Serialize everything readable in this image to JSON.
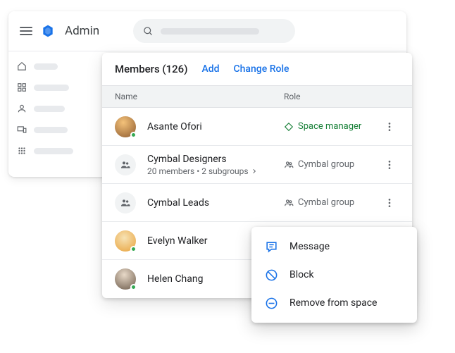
{
  "header": {
    "title": "Admin"
  },
  "members": {
    "title": "Members (126)",
    "add_label": "Add",
    "change_role_label": "Change Role",
    "col_name": "Name",
    "col_role": "Role",
    "rows": [
      {
        "name": "Asante Ofori",
        "role": "Space manager"
      },
      {
        "name": "Cymbal Designers",
        "sub": "20 members  •  2 subgroups",
        "role": "Cymbal group"
      },
      {
        "name": "Cymbal Leads",
        "role": "Cymbal group"
      },
      {
        "name": "Evelyn Walker"
      },
      {
        "name": "Helen Chang"
      }
    ]
  },
  "menu": {
    "message": "Message",
    "block": "Block",
    "remove": "Remove from space"
  }
}
